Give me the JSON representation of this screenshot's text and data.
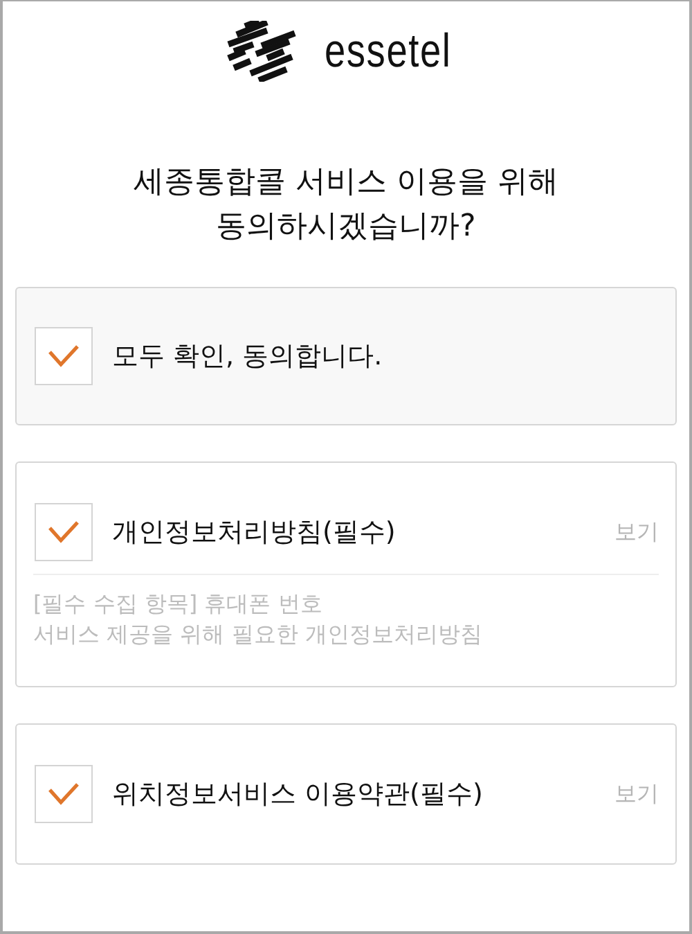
{
  "logo": {
    "wordmark": "essetel"
  },
  "heading": [
    "세종통합콜 서비스 이용을 위해",
    "동의하시겠습니까?"
  ],
  "agree_all": {
    "label": "모두 확인, 동의합니다.",
    "checked": true
  },
  "agreements": [
    {
      "label": "개인정보처리방침(필수)",
      "checked": true,
      "view_link": "보기",
      "details": [
        "[필수 수집 항목] 휴대폰 번호",
        "서비스 제공을 위해 필요한 개인정보처리방침"
      ]
    },
    {
      "label": "위치정보서비스 이용약관(필수)",
      "checked": true,
      "view_link": "보기"
    }
  ]
}
